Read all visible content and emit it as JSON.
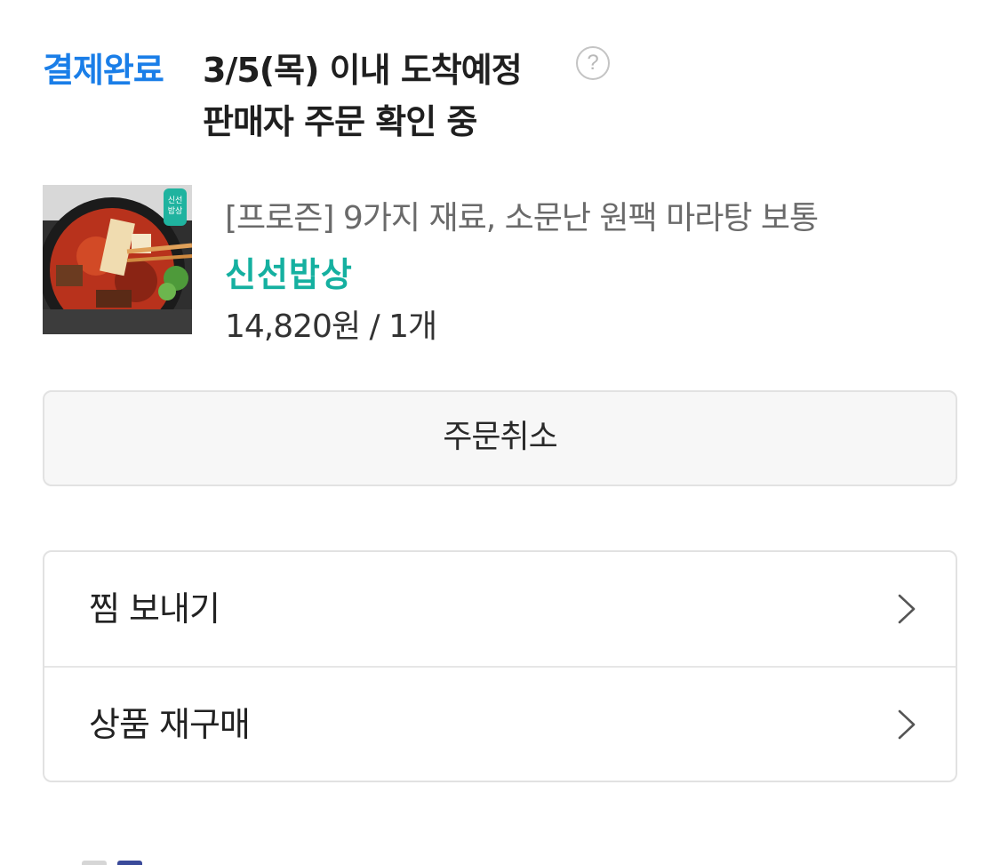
{
  "order": {
    "status_label": "결제완료",
    "delivery_text": "3/5(목) 이내 도착예정",
    "help_icon": "question-circle-icon",
    "seller_status": "판매자 주문 확인 중"
  },
  "product": {
    "name": "[프로즌] 9가지 재료, 소문난 원팩 마라탕 보통",
    "shop": "신선밥상",
    "price": "14,820원 / 1개",
    "image": "product-thumbnail-image",
    "badge_text": "신선\n밥상"
  },
  "actions": {
    "cancel_label": "주문취소"
  },
  "menu": [
    {
      "label": "찜 보내기",
      "icon": "chevron-right-icon"
    },
    {
      "label": "상품 재구매",
      "icon": "chevron-right-icon"
    }
  ],
  "colors": {
    "status_blue": "#1a7ee8",
    "shop_teal": "#15b0a0",
    "border_gray": "#e2e2e2",
    "button_bg": "#f7f7f7"
  }
}
